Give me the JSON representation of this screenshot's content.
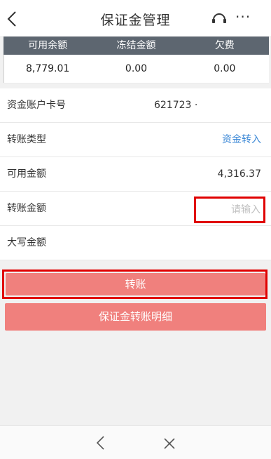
{
  "header": {
    "title": "保证金管理",
    "more_label": "···",
    "icons": {
      "back": "back-arrow-icon",
      "service": "headset-icon",
      "more": "more-dots-icon"
    }
  },
  "balance": {
    "columns": [
      "可用余额",
      "冻结金额",
      "欠费"
    ],
    "values": [
      "8,779.01",
      "0.00",
      "0.00"
    ]
  },
  "form": {
    "card_label": "资金账户卡号",
    "card_value": "621723 ·",
    "type_label": "转账类型",
    "type_value": "资金转入",
    "available_label": "可用金额",
    "available_value": "4,316.37",
    "amount_label": "转账金额",
    "amount_placeholder": "请输入",
    "uppercase_label": "大写金额"
  },
  "buttons": {
    "transfer": "转账",
    "detail": "保证金转账明细"
  },
  "bottom_nav": {
    "icons": [
      "back-chevron-icon",
      "close-x-icon"
    ]
  },
  "colors": {
    "accent_button": "#f0807d",
    "link_blue": "#3a87d6",
    "highlight_red": "#e00000",
    "table_head": "#5d6670"
  }
}
